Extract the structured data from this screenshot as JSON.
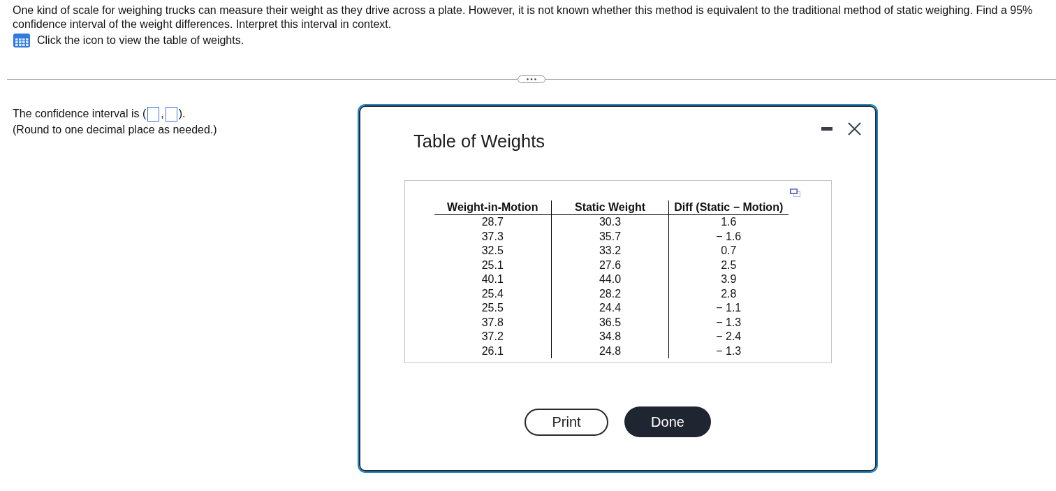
{
  "question": {
    "text": "One kind of scale for weighing trucks can measure their weight as they drive across a plate. However, it is not known whether this method is equivalent to the traditional method of static weighing. Find a 95% confidence interval of the weight differences. Interpret this interval in context.",
    "hint": "Click the icon to view the table of weights."
  },
  "answer": {
    "parts": [
      {
        "kind": "text",
        "text": "The confidence interval is ("
      },
      {
        "kind": "blank"
      },
      {
        "kind": "text",
        "text": ","
      },
      {
        "kind": "blank"
      },
      {
        "kind": "text",
        "text": ")."
      }
    ],
    "note": "(Round to one decimal place as needed.)"
  },
  "dialog": {
    "title": "Table of Weights",
    "table": {
      "columns": [
        "Weight-in-Motion",
        "Static Weight",
        "Diff (Static − Motion)"
      ],
      "rows": [
        [
          "28.7",
          "30.3",
          "1.6"
        ],
        [
          "37.3",
          "35.7",
          "− 1.6"
        ],
        [
          "32.5",
          "33.2",
          "0.7"
        ],
        [
          "25.1",
          "27.6",
          "2.5"
        ],
        [
          "40.1",
          "44.0",
          "3.9"
        ],
        [
          "25.4",
          "28.2",
          "2.8"
        ],
        [
          "25.5",
          "24.4",
          "− 1.1"
        ],
        [
          "37.8",
          "36.5",
          "− 1.3"
        ],
        [
          "37.2",
          "34.8",
          "− 2.4"
        ],
        [
          "26.1",
          "24.8",
          "− 1.3"
        ]
      ]
    },
    "buttons": [
      {
        "label": "Print",
        "kind": "outlined"
      },
      {
        "label": "Done",
        "kind": "filled"
      }
    ]
  }
}
